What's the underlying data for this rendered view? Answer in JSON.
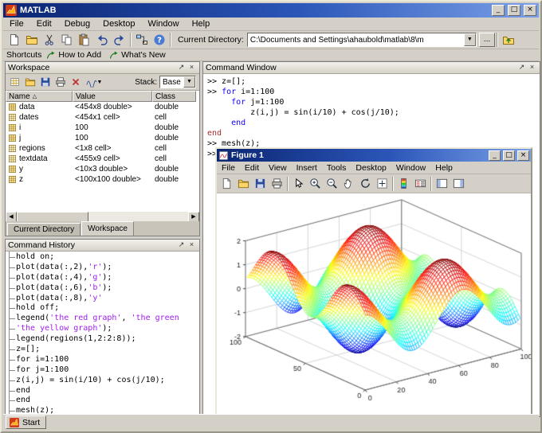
{
  "window": {
    "title": "MATLAB"
  },
  "window_controls": {
    "minimize": "_",
    "maximize": "□",
    "close": "×"
  },
  "panel_controls": {
    "dock": "↗",
    "close": "×"
  },
  "menubar": {
    "items": [
      "File",
      "Edit",
      "Debug",
      "Desktop",
      "Window",
      "Help"
    ]
  },
  "main_toolbar": {
    "icons": [
      "new-file",
      "open-folder",
      "cut",
      "copy",
      "paste",
      "undo",
      "redo",
      "|",
      "simulink",
      "help"
    ],
    "current_directory_label": "Current Directory:",
    "current_directory_value": "C:\\Documents and Settings\\ahaubold\\matlab\\8\\m",
    "browse_button": "...",
    "updir_icon": "cd-up"
  },
  "shortcuts": {
    "label": "Shortcuts",
    "items": [
      {
        "icon": "shortcut-arrow",
        "label": "How to Add"
      },
      {
        "icon": "shortcut-arrow",
        "label": "What's New"
      }
    ]
  },
  "workspace": {
    "title": "Workspace",
    "toolbar_icons": [
      "new-variable",
      "open-folder",
      "save",
      "print",
      "delete"
    ],
    "plot_selector_icon": "plot-wave",
    "stack_label": "Stack:",
    "stack_value": "Base",
    "columns": [
      "Name",
      "Value",
      "Class"
    ],
    "sort_indicator": "△",
    "rows": [
      {
        "icon": "var-grid",
        "name": "data",
        "value": "<454x8 double>",
        "class": "double"
      },
      {
        "icon": "var-cell",
        "name": "dates",
        "value": "<454x1 cell>",
        "class": "cell"
      },
      {
        "icon": "var-grid",
        "name": "i",
        "value": "100",
        "class": "double"
      },
      {
        "icon": "var-grid",
        "name": "j",
        "value": "100",
        "class": "double"
      },
      {
        "icon": "var-cell",
        "name": "regions",
        "value": "<1x8 cell>",
        "class": "cell"
      },
      {
        "icon": "var-cell",
        "name": "textdata",
        "value": "<455x9 cell>",
        "class": "cell"
      },
      {
        "icon": "var-grid",
        "name": "y",
        "value": "<10x3 double>",
        "class": "double"
      },
      {
        "icon": "var-grid",
        "name": "z",
        "value": "<100x100 double>",
        "class": "double"
      }
    ],
    "tabs": [
      "Current Directory",
      "Workspace"
    ],
    "active_tab": "Workspace"
  },
  "command_history": {
    "title": "Command History",
    "lines": [
      [
        [
          "k",
          "hold on;"
        ]
      ],
      [
        [
          "k",
          "plot(data(:,2),"
        ],
        [
          "p",
          "'r'"
        ],
        [
          "k",
          ");"
        ]
      ],
      [
        [
          "k",
          "plot(data(:,4),"
        ],
        [
          "p",
          "'g'"
        ],
        [
          "k",
          ");"
        ]
      ],
      [
        [
          "k",
          "plot(data(:,6),"
        ],
        [
          "p",
          "'b'"
        ],
        [
          "k",
          ");"
        ]
      ],
      [
        [
          "k",
          "plot(data(:,8),"
        ],
        [
          "p",
          "'y'"
        ]
      ],
      [
        [
          "k",
          "hold off;"
        ]
      ],
      [
        [
          "k",
          "legend("
        ],
        [
          "p",
          "'the red graph'"
        ],
        [
          "k",
          ", "
        ],
        [
          "p",
          "'the green"
        ]
      ],
      [
        [
          "p",
          "'the yellow graph'"
        ],
        [
          "k",
          ");"
        ]
      ],
      [
        [
          "k",
          "legend(regions(1,2:2:8));"
        ]
      ],
      [
        [
          "k",
          "z=[];"
        ]
      ],
      [
        [
          "k",
          "for i=1:100"
        ]
      ],
      [
        [
          "k",
          "for j=1:100"
        ]
      ],
      [
        [
          "k",
          "z(i,j) = sin(i/10) + cos(j/10);"
        ]
      ],
      [
        [
          "k",
          "end"
        ]
      ],
      [
        [
          "k",
          "end"
        ]
      ],
      [
        [
          "k",
          "mesh(z);"
        ]
      ]
    ]
  },
  "command_window": {
    "title": "Command Window",
    "lines": [
      [
        [
          "k",
          ">> z=[];"
        ]
      ],
      [
        [
          "k",
          ">> "
        ],
        [
          "b",
          "for"
        ],
        [
          "k",
          " i=1:100"
        ]
      ],
      [
        [
          "k",
          "     "
        ],
        [
          "b",
          "for"
        ],
        [
          "k",
          " j=1:100"
        ]
      ],
      [
        [
          "k",
          "         z(i,j) = sin(i/10) + cos(j/10);"
        ]
      ],
      [
        [
          "k",
          "     "
        ],
        [
          "b",
          "end"
        ]
      ],
      [
        [
          "r",
          "end"
        ]
      ],
      [
        [
          "k",
          ">> mesh(z);"
        ]
      ],
      [
        [
          "k",
          ">>"
        ]
      ]
    ]
  },
  "figure": {
    "title": "Figure 1",
    "menubar": [
      "File",
      "Edit",
      "View",
      "Insert",
      "Tools",
      "Desktop",
      "Window",
      "Help"
    ],
    "toolbar_icons": [
      "new-file",
      "open-folder",
      "save",
      "print",
      "|",
      "pointer",
      "zoom-in",
      "zoom-out",
      "pan",
      "rotate",
      "data-cursor",
      "|",
      "colorbar",
      "legend",
      "|",
      "plot-tools-left",
      "plot-tools-right"
    ]
  },
  "taskbar": {
    "start_label": "Start"
  },
  "chart_data": {
    "type": "mesh3d",
    "title": "",
    "formula": "sin(i/10) + cos(j/10)",
    "i_range": [
      1,
      100
    ],
    "j_range": [
      1,
      100
    ],
    "x_ticks": [
      0,
      20,
      40,
      60,
      80,
      100
    ],
    "y_ticks": [
      0,
      50,
      100
    ],
    "z_ticks": [
      -2,
      -1,
      0,
      1,
      2
    ],
    "xlim": [
      0,
      100
    ],
    "ylim": [
      0,
      100
    ],
    "zlim": [
      -2,
      2
    ],
    "colormap": "jet",
    "view": {
      "azimuth": -37.5,
      "elevation": 30
    },
    "grid": true
  }
}
